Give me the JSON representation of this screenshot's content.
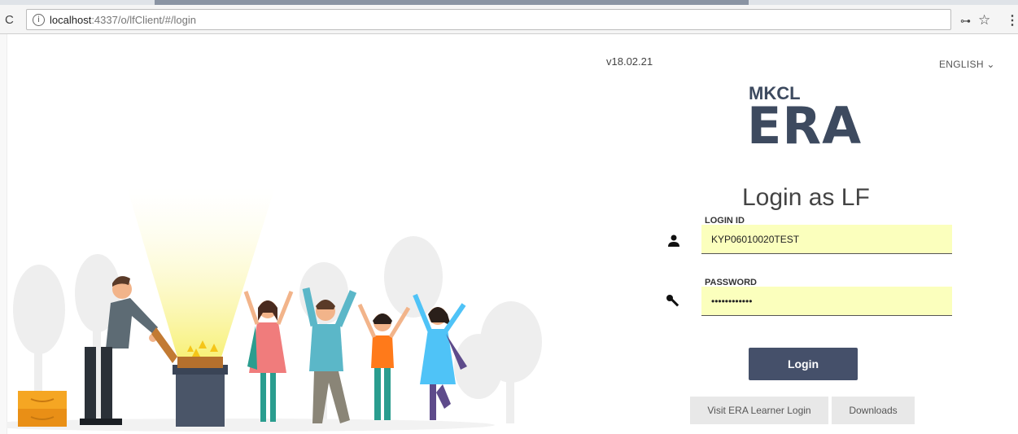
{
  "browser": {
    "url_host": "localhost",
    "url_path": ":4337/o/lfClient/#/login",
    "reload_glyph": "C",
    "info_glyph": "i",
    "key_glyph": "⊶",
    "star_glyph": "☆",
    "menu_glyph": "⋮"
  },
  "version": "v18.02.21",
  "language": "ENGLISH ⌄",
  "logo": {
    "top": "MKCL",
    "bottom": "ERA"
  },
  "heading": "Login as LF",
  "login_id": {
    "label": "LOGIN ID",
    "value": "KYP06010020TEST"
  },
  "password": {
    "label": "PASSWORD",
    "value": "••••••••••••"
  },
  "login_button": "Login",
  "learner_login_button": "Visit ERA Learner Login",
  "downloads_button": "Downloads",
  "colors": {
    "primary": "#45506a",
    "field_bg": "#fbffbd",
    "logo": "#3d4a5f"
  }
}
